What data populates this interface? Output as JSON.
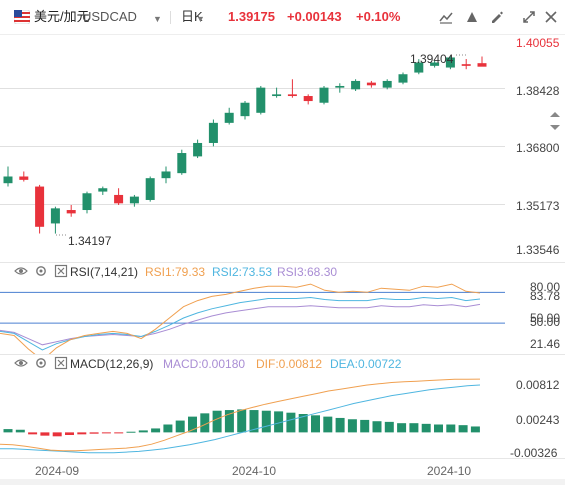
{
  "header": {
    "symbol_name": "美元/加元",
    "symbol_code": "USDCAD",
    "period": "日K",
    "price": "1.39175",
    "change": "+0.00143",
    "change_pct": "+0.10%",
    "colors": {
      "up": "#e8323b",
      "down": "#22906b"
    },
    "tool_icons": [
      "draw-tools-icon",
      "indicator-settings-icon",
      "edit-icon",
      "settings-icon",
      "fullscreen-icon",
      "close-icon"
    ]
  },
  "price_axis": [
    "1.40055",
    "1.38428",
    "1.36800",
    "1.35173",
    "1.33546"
  ],
  "price_annotations": {
    "high": "1.39404",
    "low": "1.34197"
  },
  "rsi": {
    "title": "RSI(7,14,21)",
    "rsi1": "RSI1:79.33",
    "rsi2": "RSI2:73.53",
    "rsi3": "RSI3:68.30",
    "axis": [
      "80.00",
      "83.78",
      "50.00",
      "50.00",
      "21.46"
    ],
    "colors": {
      "rsi1": "#f0a050",
      "rsi2": "#4fb6e0",
      "rsi3": "#a98dd4"
    },
    "values": {
      "rsi1": [
        40,
        38,
        25,
        14,
        26,
        34,
        38,
        40,
        42,
        40,
        35,
        44,
        55,
        66,
        72,
        76,
        78,
        81,
        84,
        86,
        86,
        85,
        88,
        82,
        80,
        81,
        80,
        84,
        83,
        82,
        86,
        85,
        88,
        81,
        79.33
      ],
      "rsi2": [
        42,
        40,
        32,
        24,
        30,
        34,
        37,
        39,
        40,
        39,
        37,
        42,
        48,
        55,
        60,
        64,
        67,
        70,
        72,
        74,
        74,
        74,
        75,
        73,
        72,
        72,
        72,
        74,
        73,
        73,
        75,
        74,
        75,
        72,
        73.53
      ],
      "rsi3": [
        43,
        41,
        35,
        29,
        32,
        35,
        37,
        38,
        39,
        38,
        37,
        40,
        44,
        49,
        53,
        57,
        60,
        62,
        64,
        66,
        66,
        66,
        67,
        66,
        65,
        65,
        65,
        67,
        66,
        66,
        68,
        67,
        68,
        66,
        68.3
      ]
    }
  },
  "macd": {
    "title": "MACD(12,26,9)",
    "macd": "MACD:0.00180",
    "dif": "DIF:0.00812",
    "dea": "DEA:0.00722",
    "axis": [
      "0.00812",
      "0.00243",
      "-0.00326"
    ],
    "colors": {
      "dif": "#f0a050",
      "dea": "#4fb6e0"
    },
    "hist": [
      0.0005,
      0.0004,
      -0.0003,
      -0.0005,
      -0.0006,
      -0.0004,
      -0.0003,
      -0.0002,
      -0.0001,
      -0.0001,
      0.0001,
      0.0003,
      0.0006,
      0.0012,
      0.0018,
      0.0024,
      0.0029,
      0.0033,
      0.0034,
      0.0035,
      0.0034,
      0.0033,
      0.0032,
      0.003,
      0.0028,
      0.0026,
      0.0024,
      0.0022,
      0.002,
      0.0019,
      0.0017,
      0.0016,
      0.0014,
      0.0014,
      0.0013,
      0.0012,
      0.0012,
      0.0011,
      0.0009
    ],
    "dif_line": [
      -0.0018,
      -0.0019,
      -0.0021,
      -0.0024,
      -0.0027,
      -0.0028,
      -0.0028,
      -0.0027,
      -0.0026,
      -0.0025,
      -0.0024,
      -0.0022,
      -0.0018,
      -0.0012,
      -0.0005,
      0.0002,
      0.001,
      0.0019,
      0.0027,
      0.0033,
      0.0038,
      0.0043,
      0.0047,
      0.0051,
      0.0055,
      0.0059,
      0.0063,
      0.0066,
      0.0069,
      0.0072,
      0.0074,
      0.0076,
      0.0077,
      0.0078,
      0.0079,
      0.008,
      0.0081,
      0.0081,
      0.00812
    ],
    "dea_line": [
      -0.0025,
      -0.0025,
      -0.0026,
      -0.0027,
      -0.0028,
      -0.0029,
      -0.003,
      -0.0031,
      -0.0031,
      -0.0031,
      -0.003,
      -0.0029,
      -0.0027,
      -0.0025,
      -0.0022,
      -0.0019,
      -0.0015,
      -0.0011,
      -0.0006,
      -0.0001,
      0.0004,
      0.0009,
      0.0014,
      0.0019,
      0.0024,
      0.0029,
      0.0034,
      0.0039,
      0.0044,
      0.0048,
      0.0052,
      0.0056,
      0.0059,
      0.0062,
      0.0065,
      0.0067,
      0.0069,
      0.0071,
      0.00722
    ]
  },
  "x_axis": [
    "2024-09",
    "2024-10",
    "2024-10"
  ],
  "chart_data": {
    "type": "candlestick",
    "ylim": [
      1.3335,
      1.4015
    ],
    "candles": [
      {
        "o": 1.357,
        "h": 1.362,
        "l": 1.356,
        "c": 1.359
      },
      {
        "o": 1.359,
        "h": 1.3605,
        "l": 1.3575,
        "c": 1.358
      },
      {
        "o": 1.356,
        "h": 1.3565,
        "l": 1.342,
        "c": 1.344
      },
      {
        "o": 1.345,
        "h": 1.35,
        "l": 1.34197,
        "c": 1.3495
      },
      {
        "o": 1.349,
        "h": 1.3505,
        "l": 1.347,
        "c": 1.348
      },
      {
        "o": 1.349,
        "h": 1.3545,
        "l": 1.348,
        "c": 1.354
      },
      {
        "o": 1.3545,
        "h": 1.356,
        "l": 1.3535,
        "c": 1.3555
      },
      {
        "o": 1.3535,
        "h": 1.3555,
        "l": 1.3505,
        "c": 1.351
      },
      {
        "o": 1.351,
        "h": 1.3535,
        "l": 1.35,
        "c": 1.353
      },
      {
        "o": 1.352,
        "h": 1.359,
        "l": 1.3515,
        "c": 1.3585
      },
      {
        "o": 1.3585,
        "h": 1.362,
        "l": 1.357,
        "c": 1.3605
      },
      {
        "o": 1.36,
        "h": 1.367,
        "l": 1.3595,
        "c": 1.366
      },
      {
        "o": 1.365,
        "h": 1.37,
        "l": 1.3645,
        "c": 1.369
      },
      {
        "o": 1.369,
        "h": 1.376,
        "l": 1.368,
        "c": 1.375
      },
      {
        "o": 1.375,
        "h": 1.3795,
        "l": 1.3745,
        "c": 1.378
      },
      {
        "o": 1.377,
        "h": 1.3815,
        "l": 1.376,
        "c": 1.381
      },
      {
        "o": 1.378,
        "h": 1.386,
        "l": 1.3775,
        "c": 1.3855
      },
      {
        "o": 1.383,
        "h": 1.3855,
        "l": 1.3825,
        "c": 1.3835
      },
      {
        "o": 1.3835,
        "h": 1.388,
        "l": 1.3825,
        "c": 1.383
      },
      {
        "o": 1.383,
        "h": 1.3835,
        "l": 1.3805,
        "c": 1.3815
      },
      {
        "o": 1.381,
        "h": 1.386,
        "l": 1.3805,
        "c": 1.3855
      },
      {
        "o": 1.3855,
        "h": 1.3868,
        "l": 1.384,
        "c": 1.386
      },
      {
        "o": 1.385,
        "h": 1.388,
        "l": 1.3845,
        "c": 1.3875
      },
      {
        "o": 1.387,
        "h": 1.3875,
        "l": 1.3855,
        "c": 1.3862
      },
      {
        "o": 1.3855,
        "h": 1.388,
        "l": 1.385,
        "c": 1.3875
      },
      {
        "o": 1.387,
        "h": 1.39,
        "l": 1.3865,
        "c": 1.3895
      },
      {
        "o": 1.39,
        "h": 1.394,
        "l": 1.3895,
        "c": 1.393
      },
      {
        "o": 1.392,
        "h": 1.3935,
        "l": 1.3915,
        "c": 1.393
      },
      {
        "o": 1.3915,
        "h": 1.395,
        "l": 1.391,
        "c": 1.3945
      },
      {
        "o": 1.3925,
        "h": 1.39404,
        "l": 1.391,
        "c": 1.392
      },
      {
        "o": 1.3928,
        "h": 1.3948,
        "l": 1.3925,
        "c": 1.39175
      }
    ]
  }
}
